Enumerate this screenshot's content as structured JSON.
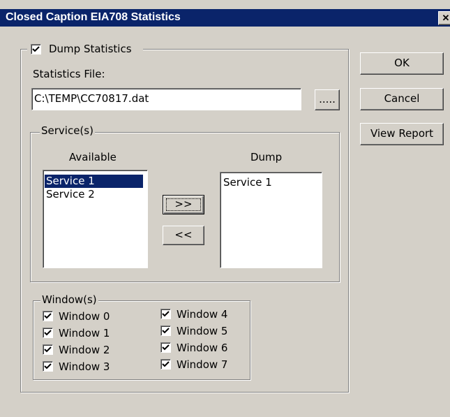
{
  "dialog": {
    "title": "Closed Caption EIA708 Statistics",
    "close_glyph": "✕"
  },
  "dump_statistics": {
    "label": "Dump Statistics",
    "checked": true
  },
  "statistics_file": {
    "label": "Statistics File:",
    "value": "C:\\TEMP\\CC70817.dat",
    "browse_label": "....."
  },
  "services": {
    "group_label": "Service(s)",
    "available_header": "Available",
    "dump_header": "Dump",
    "available_items": [
      "Service 1",
      "Service 2"
    ],
    "selected_available": "Service 1",
    "dump_items": [
      "Service 1"
    ],
    "add_button": ">>",
    "remove_button": "<<"
  },
  "windows": {
    "group_label": "Window(s)",
    "items": [
      {
        "label": "Window 0",
        "checked": true
      },
      {
        "label": "Window 1",
        "checked": true
      },
      {
        "label": "Window 2",
        "checked": true
      },
      {
        "label": "Window 3",
        "checked": true
      },
      {
        "label": "Window 4",
        "checked": true
      },
      {
        "label": "Window 5",
        "checked": true
      },
      {
        "label": "Window 6",
        "checked": true
      },
      {
        "label": "Window 7",
        "checked": true
      }
    ]
  },
  "buttons": {
    "ok": "OK",
    "cancel": "Cancel",
    "view_report": "View Report"
  },
  "colors": {
    "face": "#d4d0c8",
    "titlebar": "#0a246a",
    "selection": "#0a246a"
  }
}
